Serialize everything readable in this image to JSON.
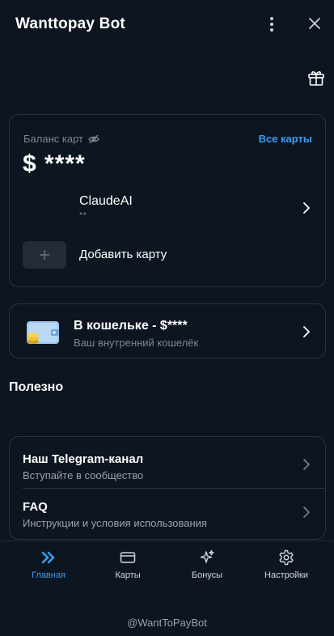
{
  "header": {
    "title": "Wanttopay Bot"
  },
  "balance": {
    "label": "Баланс карт",
    "all_cards": "Все карты",
    "value": "$ ****",
    "card": {
      "name": "ClaudeAI",
      "number": "**"
    },
    "add_card_label": "Добавить карту"
  },
  "wallet": {
    "title": "В кошельке - $****",
    "subtitle": "Ваш внутренний кошелёк"
  },
  "useful": {
    "title": "Полезно",
    "items": [
      {
        "title": "Наш Telegram-канал",
        "subtitle": "Вступайте в сообщество"
      },
      {
        "title": "FAQ",
        "subtitle": "Инструкции и условия использования"
      }
    ]
  },
  "nav": [
    {
      "label": "Главная",
      "icon": "double-chevron-icon",
      "active": true
    },
    {
      "label": "Карты",
      "icon": "card-icon",
      "active": false
    },
    {
      "label": "Бонусы",
      "icon": "sparkles-icon",
      "active": false
    },
    {
      "label": "Настройки",
      "icon": "gear-icon",
      "active": false
    }
  ],
  "footer": {
    "handle": "@WantToPayBot"
  },
  "colors": {
    "background": "#0d1620",
    "accent": "#3d9bf0",
    "border": "#2a333e"
  }
}
